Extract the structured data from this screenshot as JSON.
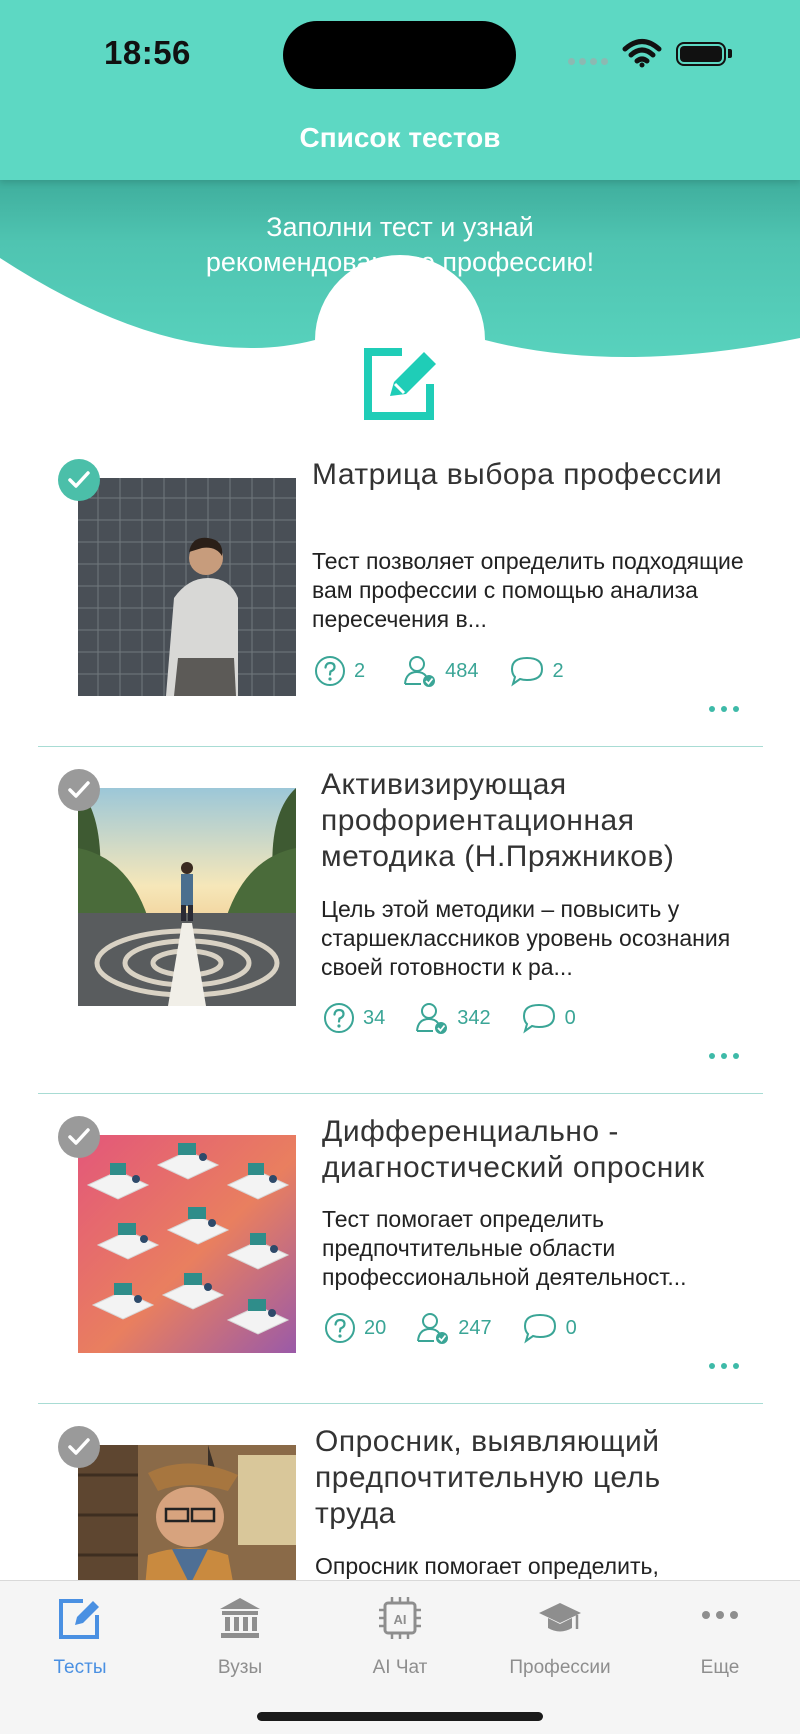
{
  "status": {
    "time": "18:56"
  },
  "nav": {
    "title": "Список тестов"
  },
  "banner": {
    "line1": "Заполни тест и узнай",
    "line2": "рекомендованную профессию!"
  },
  "tests": [
    {
      "title": "Матрица выбора профессии",
      "description": "Тест позволяет определить подходящие вам профессии с помощью анализа пересечения в...",
      "questions": "2",
      "participants": "484",
      "comments": "2",
      "completed": true
    },
    {
      "title": "Активизирующая профориентационная методика (Н.Пряжников)",
      "description": "Цель этой методики – повысить у старшеклассников уровень осознания своей готовности к ра...",
      "questions": "34",
      "participants": "342",
      "comments": "0",
      "completed": false
    },
    {
      "title": "Дифференциально - диагностический опросник",
      "description": "Тест помогает определить предпочтительные области профессиональной деятельност...",
      "questions": "20",
      "participants": "247",
      "comments": "0",
      "completed": false
    },
    {
      "title": "Опросник, выявляющий предпочтительную цель труда",
      "description": "Опросник помогает определить,",
      "completed": false
    }
  ],
  "tabs": [
    {
      "label": "Тесты",
      "icon": "edit-icon",
      "active": true
    },
    {
      "label": "Вузы",
      "icon": "university-icon",
      "active": false
    },
    {
      "label": "AI Чат",
      "icon": "ai-chip-icon",
      "active": false
    },
    {
      "label": "Профессии",
      "icon": "graduation-cap-icon",
      "active": false
    },
    {
      "label": "Еще",
      "icon": "more-icon",
      "active": false
    }
  ],
  "colors": {
    "accent": "#5dd8c3",
    "teal_text": "#3aa596",
    "tab_active": "#4a90e2"
  }
}
